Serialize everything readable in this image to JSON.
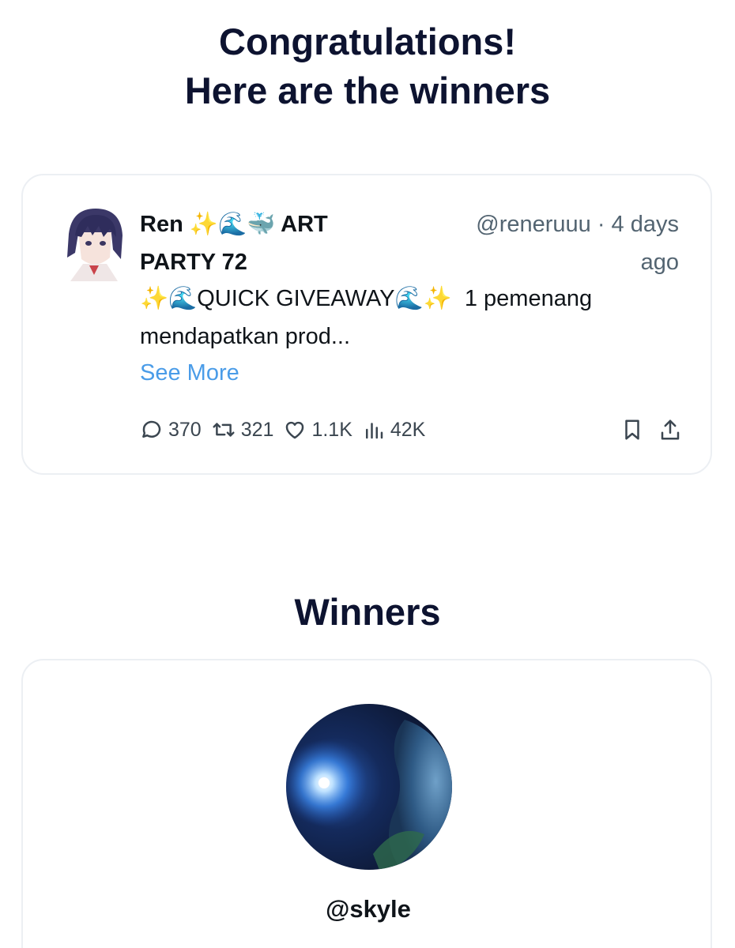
{
  "header": {
    "line1": "Congratulations!",
    "line2": "Here are the winners"
  },
  "tweet": {
    "name_line1": "Ren ✨🌊🐳 ART",
    "name_line2": "PARTY 72",
    "handle_line1": "@reneruuu · 4 days",
    "handle_line2": "ago",
    "text_line1": "✨🌊QUICK GIVEAWAY🌊✨  1 pemenang",
    "text_line2": "mendapatkan prod...",
    "see_more": "See More",
    "replies": "370",
    "retweets": "321",
    "likes": "1.1K",
    "views": "42K",
    "icons": [
      "reply-icon",
      "retweet-icon",
      "like-icon",
      "views-icon",
      "bookmark-icon",
      "share-icon"
    ]
  },
  "winners": {
    "title": "Winners",
    "items": [
      {
        "handle": "@skyle"
      }
    ]
  },
  "colors": {
    "heading": "#0d1330",
    "link": "#4a9ce8",
    "muted": "#536471",
    "border": "#eceff3"
  }
}
